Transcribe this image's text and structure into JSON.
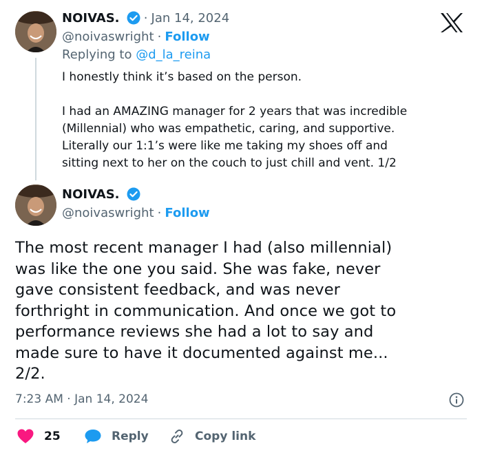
{
  "reply_tweet": {
    "display_name": "NOIVAS.",
    "date": "Jan 14, 2024",
    "handle": "@noivaswright",
    "follow_label": "Follow",
    "replying_prefix": "Replying to",
    "replying_to": "@d_la_reina",
    "text": "I honestly think it’s based on the person.\n\nI had an AMAZING manager for 2 years that was incredible\n(Millennial) who was empathetic, caring, and supportive.\nLiterally our 1:1’s were like me taking my shoes off and\nsitting next to her on the couch to just chill and vent. 1/2"
  },
  "main_tweet": {
    "display_name": "NOIVAS.",
    "handle": "@noivaswright",
    "follow_label": "Follow",
    "text": "The most recent manager I had (also millennial)\nwas like the one you said. She was fake, never\ngave consistent feedback, and was never\nforthright in communication. And once we got to\nperformance reviews she had a lot to say and\nmade sure to have it documented against me...\n2/2.",
    "timestamp": "7:23 AM · Jan 14, 2024"
  },
  "actions": {
    "likes": "25",
    "reply_label": "Reply",
    "copy_label": "Copy link"
  },
  "separator": "·",
  "colors": {
    "accent": "#1d9bf0",
    "like": "#f91880",
    "text": "#0f1419",
    "muted": "#536471"
  },
  "icons": [
    "x-logo-icon",
    "verified-badge-icon",
    "info-icon",
    "heart-icon",
    "reply-bubble-icon",
    "link-icon"
  ]
}
